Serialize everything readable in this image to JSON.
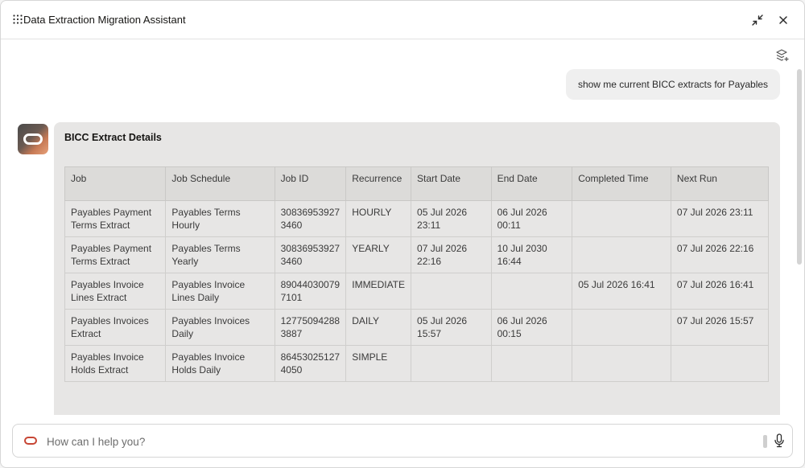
{
  "header": {
    "title": "Data Extraction Migration Assistant",
    "menu_icon": "grid-dots-icon",
    "collapse_icon": "collapse-arrows-icon",
    "close_icon": "close-icon"
  },
  "conversation": {
    "user_message": "show me current BICC extracts for Payables",
    "bot_card": {
      "title": "BICC Extract Details",
      "columns": [
        "Job",
        "Job Schedule",
        "Job ID",
        "Recurrence",
        "Start Date",
        "End Date",
        "Completed Time",
        "Next Run"
      ],
      "rows": [
        [
          "Payables Payment Terms Extract",
          "Payables Terms Hourly",
          "308369539273460",
          "HOURLY",
          "05 Jul 2026 23:11",
          "06 Jul 2026 00:11",
          "",
          "07 Jul 2026 23:11"
        ],
        [
          "Payables Payment Terms Extract",
          "Payables Terms Yearly",
          "308369539273460",
          "YEARLY",
          "07 Jul 2026 22:16",
          "10 Jul 2030 16:44",
          "",
          "07 Jul 2026 22:16"
        ],
        [
          "Payables Invoice Lines Extract",
          "Payables Invoice Lines Daily",
          "890440300797101",
          "IMMEDIATE",
          "",
          "",
          "05 Jul 2026 16:41",
          "07 Jul 2026 16:41"
        ],
        [
          "Payables Invoices Extract",
          "Payables Invoices Daily",
          "127750942883887",
          "DAILY",
          "05 Jul 2026 15:57",
          "06 Jul 2026 00:15",
          "",
          "07 Jul 2026 15:57"
        ],
        [
          "Payables Invoice Holds Extract",
          "Payables Invoice Holds Daily",
          "864530251274050",
          "SIMPLE",
          "",
          "",
          "",
          ""
        ]
      ]
    }
  },
  "input": {
    "placeholder": "How can I help you?",
    "value": ""
  },
  "colors": {
    "accent": "#c74634",
    "card_bg": "#e7e6e5",
    "header_row_bg": "#dcdbd9",
    "bubble_bg": "#efefef"
  }
}
